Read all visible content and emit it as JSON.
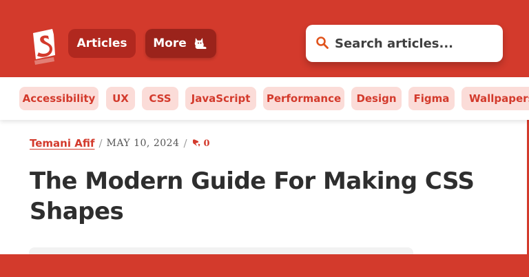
{
  "header": {
    "nav": {
      "articles_label": "Articles",
      "more_label": "More"
    },
    "search": {
      "placeholder": "Search articles..."
    }
  },
  "tags": [
    "Accessibility",
    "UX",
    "CSS",
    "JavaScript",
    "Performance",
    "Design",
    "Figma",
    "Wallpapers"
  ],
  "article": {
    "author": "Temani Afif",
    "separator": "/",
    "date": "MAY 10, 2024",
    "comment_count": "0",
    "title": "The Modern Guide For Making CSS Shapes"
  },
  "colors": {
    "brand": "#d33a2c",
    "nav_dark": "#b1281f",
    "tag_bg": "#fbdcd8",
    "text": "#2e2e2e"
  },
  "icons": {
    "logo": "smashing-logo",
    "more": "cat-icon",
    "search": "search-icon",
    "comments": "comments-icon"
  }
}
